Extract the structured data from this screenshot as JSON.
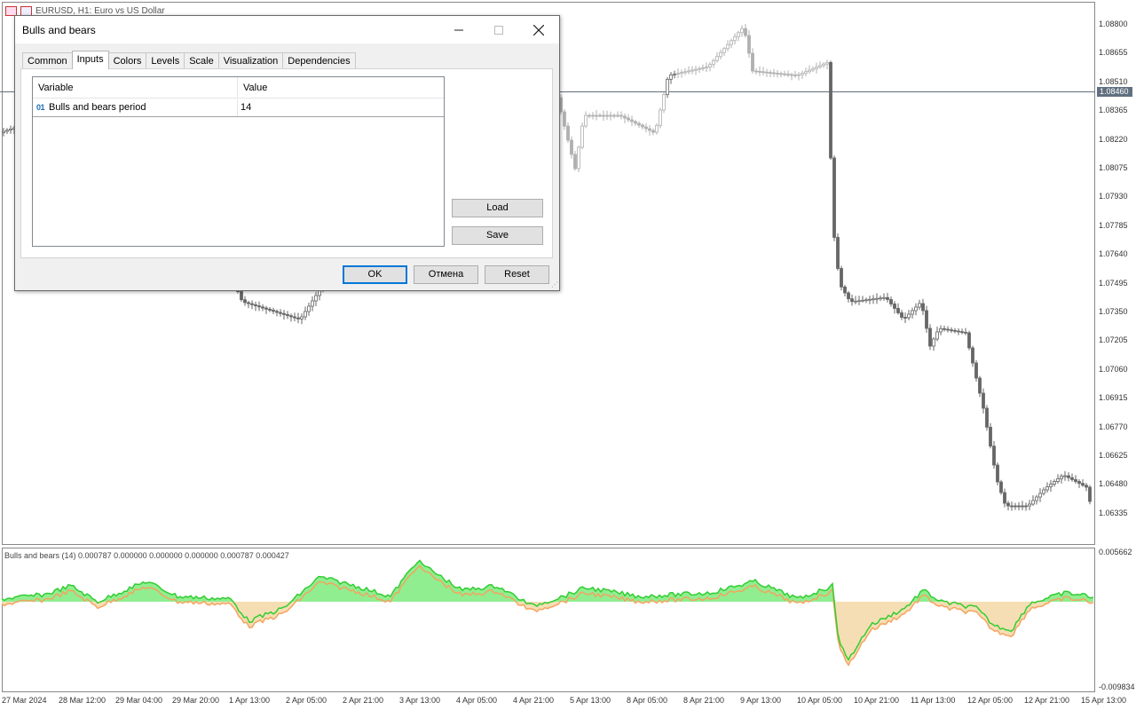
{
  "window": {
    "chart_title": "EURUSD, H1:  Euro vs US Dollar"
  },
  "dialog": {
    "title": "Bulls and bears",
    "tabs": [
      {
        "label": "Common"
      },
      {
        "label": "Inputs",
        "active": true
      },
      {
        "label": "Colors"
      },
      {
        "label": "Levels"
      },
      {
        "label": "Scale"
      },
      {
        "label": "Visualization"
      },
      {
        "label": "Dependencies"
      }
    ],
    "grid": {
      "headers": {
        "variable": "Variable",
        "value": "Value"
      },
      "rows": [
        {
          "icon": "01",
          "name": "Bulls and bears period",
          "value": "14"
        }
      ]
    },
    "load_label": "Load",
    "save_label": "Save",
    "ok_label": "OK",
    "cancel_label": "Отмена",
    "reset_label": "Reset"
  },
  "chart": {
    "current_price": "1.08460",
    "price_labels": [
      "1.08800",
      "1.08655",
      "1.08510",
      "1.08365",
      "1.08220",
      "1.08075",
      "1.07930",
      "1.07785",
      "1.07640",
      "1.07495",
      "1.07350",
      "1.07205",
      "1.07060",
      "1.06915",
      "1.06770",
      "1.06625",
      "1.06480",
      "1.06335"
    ],
    "time_labels": [
      "27 Mar 2024",
      "28 Mar 12:00",
      "29 Mar 04:00",
      "29 Mar 20:00",
      "1 Apr 13:00",
      "2 Apr 05:00",
      "2 Apr 21:00",
      "3 Apr 13:00",
      "4 Apr 05:00",
      "4 Apr 21:00",
      "5 Apr 13:00",
      "8 Apr 05:00",
      "8 Apr 21:00",
      "9 Apr 13:00",
      "10 Apr 05:00",
      "10 Apr 21:00",
      "11 Apr 13:00",
      "12 Apr 05:00",
      "12 Apr 21:00",
      "15 Apr 13:00"
    ],
    "indicator_label": "Bulls and bears (14) 0.000787 0.000000 0.000000 0.000000 0.000787 0.000427",
    "indicator_max": "0.005662",
    "indicator_min": "-0.009834",
    "colors": {
      "bull_line": "#32cd32",
      "bull_fill": "#90ee90",
      "bear_line": "#f4a460",
      "bear_fill": "#f5deb3",
      "candle": "#666666",
      "price_line": "#607080"
    }
  }
}
